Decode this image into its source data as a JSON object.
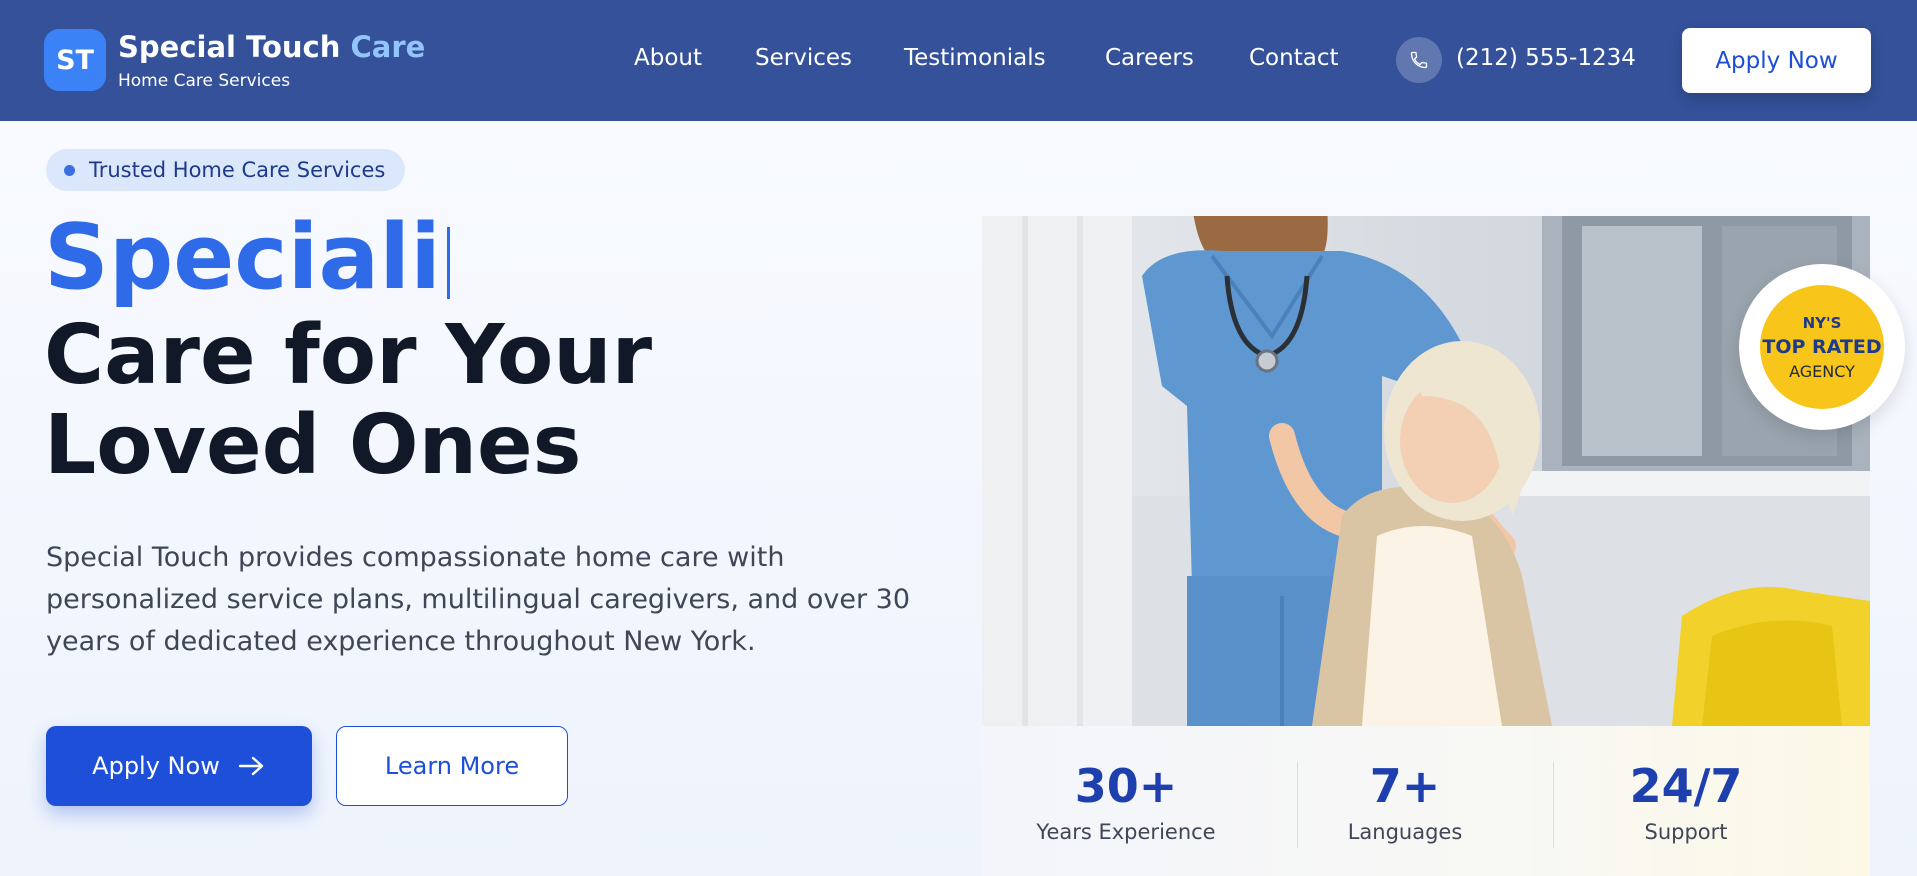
{
  "header": {
    "logo_initials": "ST",
    "brand_name": "Special Touch",
    "brand_accent": "Care",
    "brand_tagline": "Home Care Services",
    "nav": [
      "About",
      "Services",
      "Testimonials",
      "Careers",
      "Contact"
    ],
    "phone": "(212) 555-1234",
    "apply_label": "Apply Now"
  },
  "hero": {
    "pill_text": "Trusted Home Care Services",
    "headline_typed": "Speciali",
    "headline_line2": "Care for Your",
    "headline_line3": "Loved Ones",
    "lead": "Special Touch provides compassionate home care with personalized service plans, multilingual caregivers, and over 30 years of dedicated experience throughout New York.",
    "primary_cta": "Apply Now",
    "secondary_cta": "Learn More"
  },
  "badge": {
    "line1": "NY'S",
    "line2": "TOP RATED",
    "line3": "AGENCY"
  },
  "stats": [
    {
      "value": "30+",
      "label": "Years Experience"
    },
    {
      "value": "7+",
      "label": "Languages"
    },
    {
      "value": "24/7",
      "label": "Support"
    }
  ],
  "colors": {
    "header_bg": "#34519a",
    "accent_blue": "#2f6be8",
    "primary_button": "#1e4fd8",
    "badge_yellow": "#f8c51a"
  },
  "icons": {
    "phone": "phone-icon",
    "arrow": "arrow-right-icon"
  }
}
